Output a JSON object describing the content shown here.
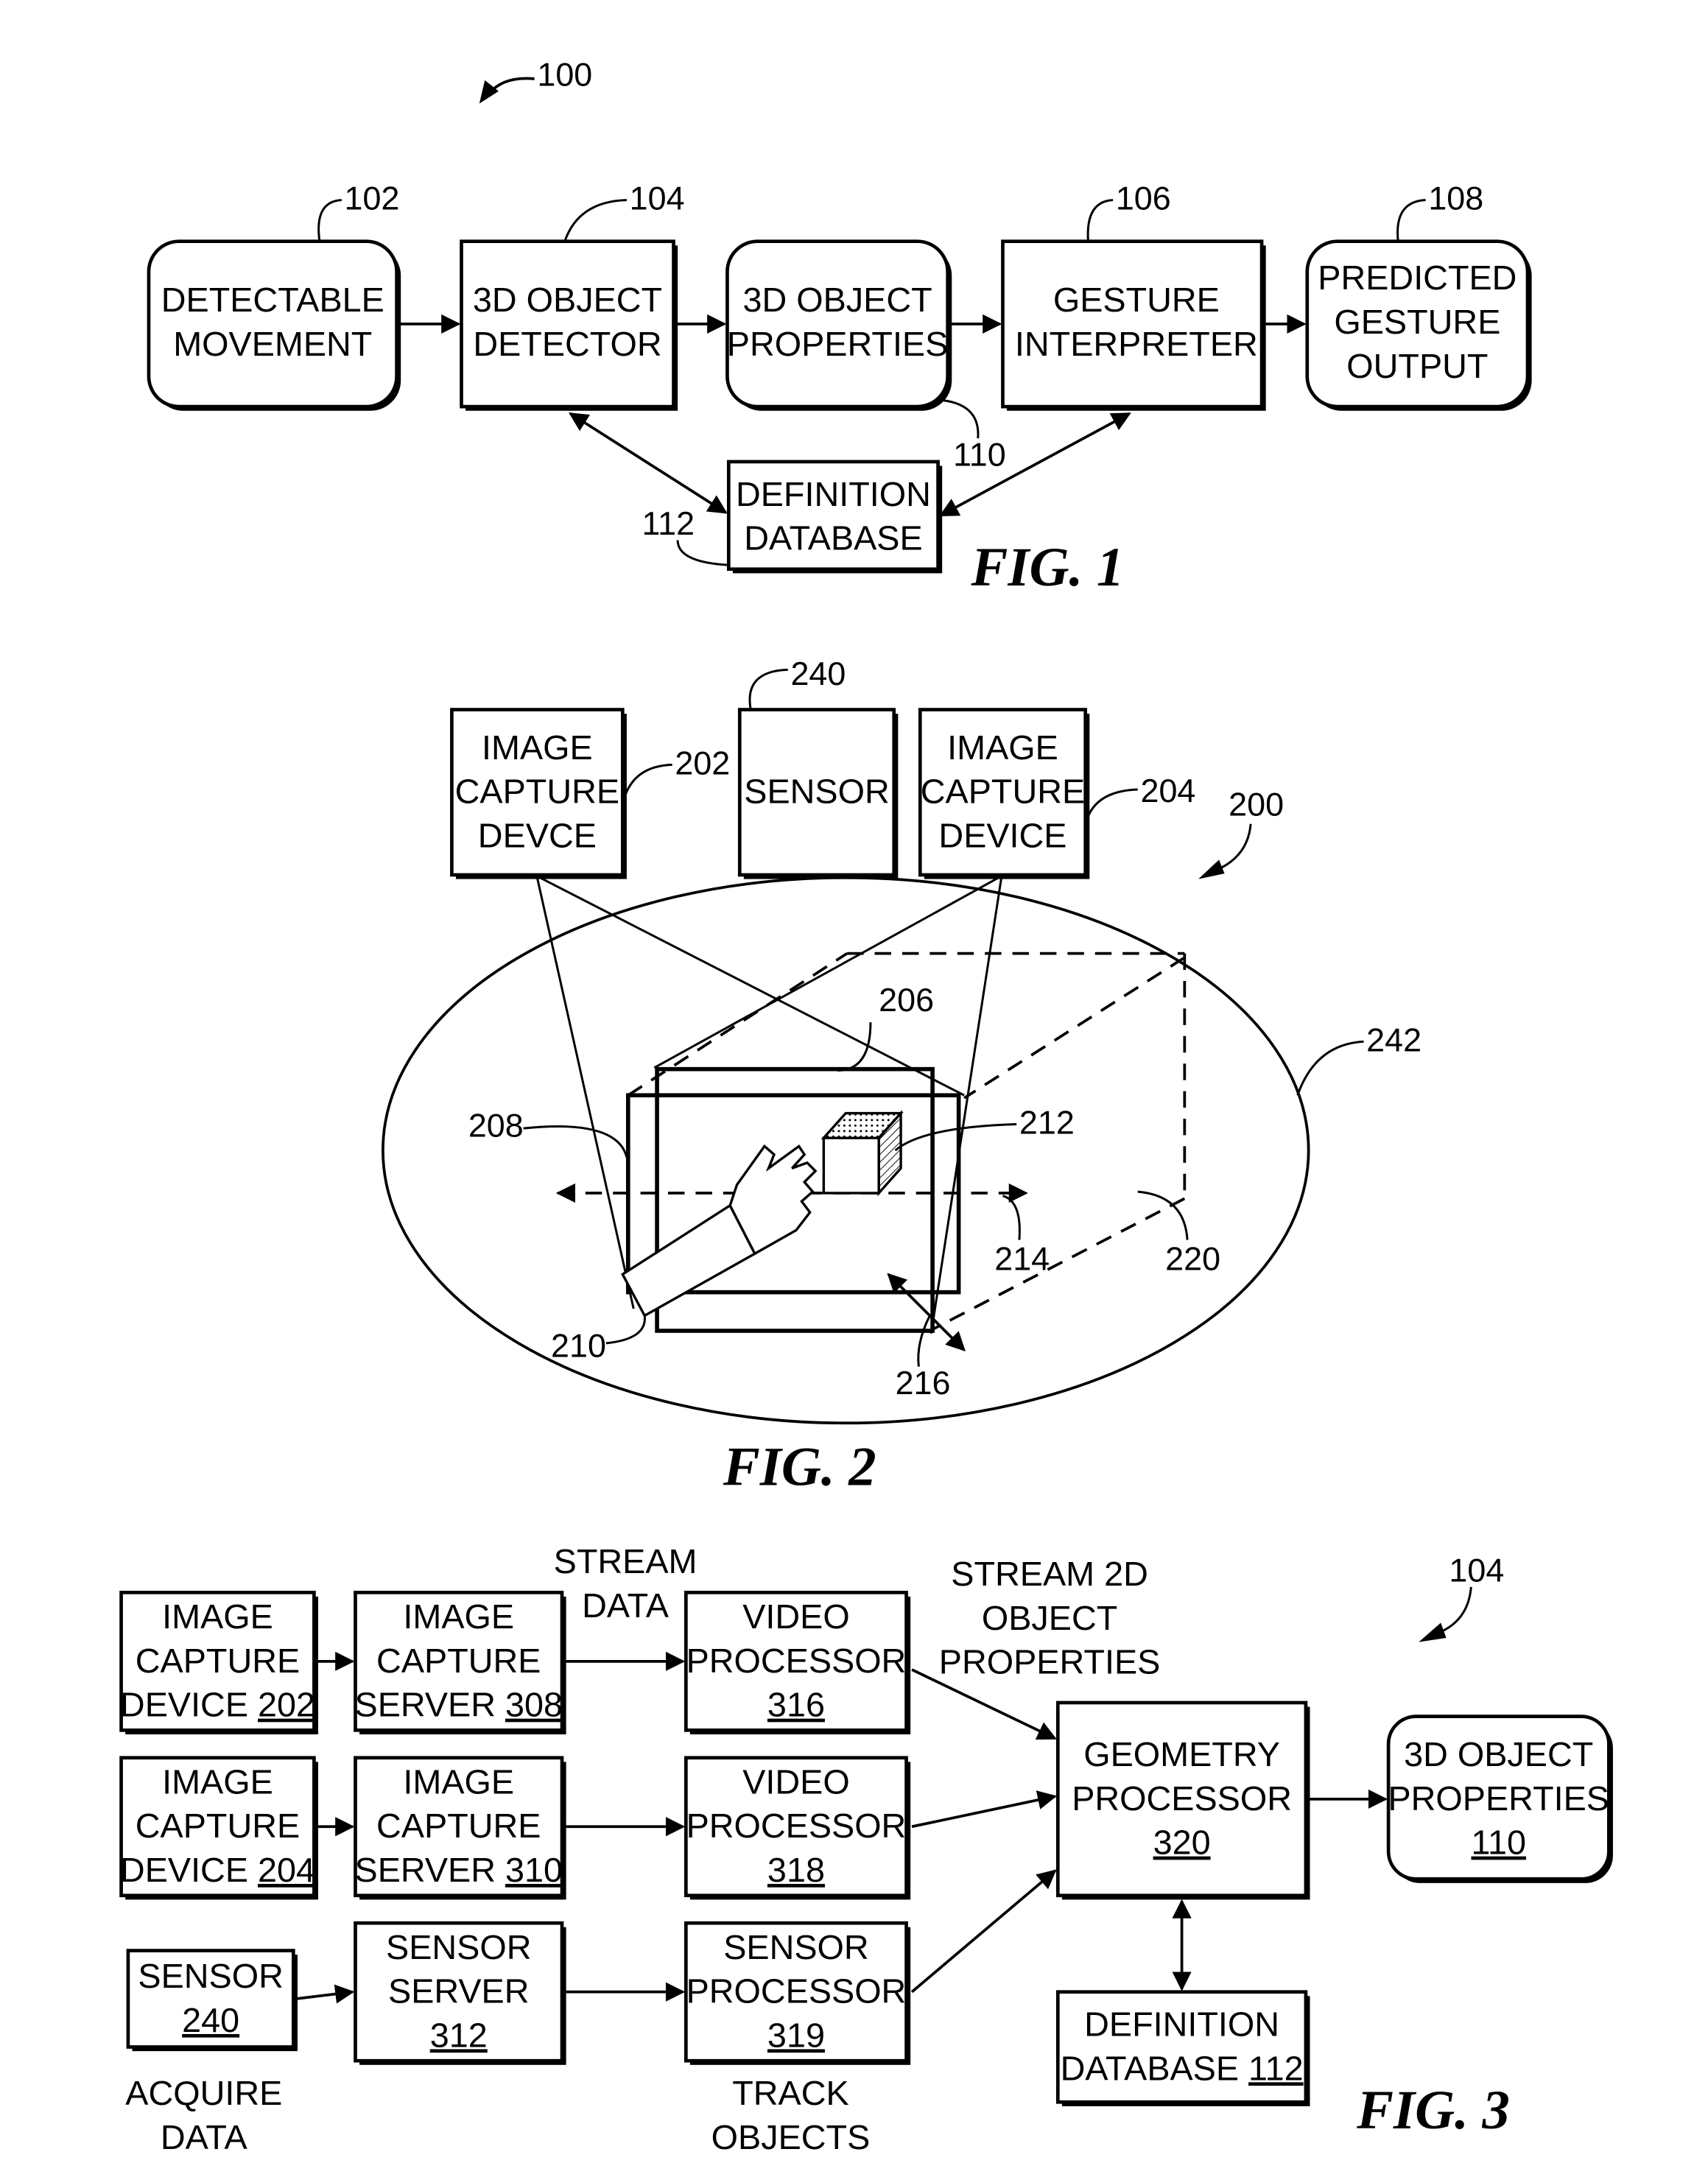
{
  "figures": {
    "fig1": {
      "title": "FIG. 1",
      "ref_system": "100",
      "blocks": [
        {
          "ref": "102",
          "lines": [
            "DETECTABLE",
            "MOVEMENT"
          ],
          "shape": "rounded"
        },
        {
          "ref": "104",
          "lines": [
            "3D OBJECT",
            "DETECTOR"
          ],
          "shape": "rect"
        },
        {
          "ref": "110",
          "lines": [
            "3D OBJECT",
            "PROPERTIES"
          ],
          "shape": "rounded"
        },
        {
          "ref": "106",
          "lines": [
            "GESTURE",
            "INTERPRETER"
          ],
          "shape": "rect"
        },
        {
          "ref": "108",
          "lines": [
            "PREDICTED",
            "GESTURE",
            "OUTPUT"
          ],
          "shape": "rounded"
        },
        {
          "ref": "112",
          "lines": [
            "DEFINITION",
            "DATABASE"
          ],
          "shape": "rect"
        }
      ]
    },
    "fig2": {
      "title": "FIG. 2",
      "ref_system": "200",
      "blocks": [
        {
          "ref": "202",
          "lines": [
            "IMAGE",
            "CAPTURE",
            "DEVCE"
          ]
        },
        {
          "ref": "240",
          "lines": [
            "SENSOR"
          ]
        },
        {
          "ref": "204",
          "lines": [
            "IMAGE",
            "CAPTURE",
            "DEVICE"
          ]
        }
      ],
      "refs": [
        "206",
        "208",
        "210",
        "212",
        "214",
        "216",
        "220",
        "242"
      ]
    },
    "fig3": {
      "title": "FIG. 3",
      "ref_system": "104",
      "blocks": [
        {
          "id": "icd202",
          "lines": [
            "IMAGE",
            "CAPTURE",
            "DEVICE"
          ],
          "num": "202"
        },
        {
          "id": "ics308",
          "lines": [
            "IMAGE",
            "CAPTURE",
            "SERVER"
          ],
          "num": "308"
        },
        {
          "id": "vp316",
          "lines": [
            "VIDEO",
            "PROCESSOR"
          ],
          "num": "316"
        },
        {
          "id": "icd204",
          "lines": [
            "IMAGE",
            "CAPTURE",
            "DEVICE"
          ],
          "num": "204"
        },
        {
          "id": "ics310",
          "lines": [
            "IMAGE",
            "CAPTURE",
            "SERVER"
          ],
          "num": "310"
        },
        {
          "id": "vp318",
          "lines": [
            "VIDEO",
            "PROCESSOR"
          ],
          "num": "318"
        },
        {
          "id": "s240",
          "lines": [
            "SENSOR"
          ],
          "num": "240"
        },
        {
          "id": "ss312",
          "lines": [
            "SENSOR",
            "SERVER"
          ],
          "num": "312"
        },
        {
          "id": "sp319",
          "lines": [
            "SENSOR",
            "PROCESSOR"
          ],
          "num": "319"
        },
        {
          "id": "gp320",
          "lines": [
            "GEOMETRY",
            "PROCESSOR"
          ],
          "num": "320"
        },
        {
          "id": "op110",
          "lines": [
            "3D OBJECT",
            "PROPERTIES"
          ],
          "num": "110"
        },
        {
          "id": "dd112",
          "lines": [
            "DEFINITION",
            "DATABASE"
          ],
          "num": "112"
        }
      ],
      "annotations": {
        "stream_data": [
          "STREAM",
          "DATA"
        ],
        "stream_2d": [
          "STREAM 2D",
          "OBJECT",
          "PROPERTIES"
        ],
        "acquire_data": [
          "ACQUIRE",
          "DATA"
        ],
        "track_objects": [
          "TRACK",
          "OBJECTS"
        ]
      }
    }
  }
}
